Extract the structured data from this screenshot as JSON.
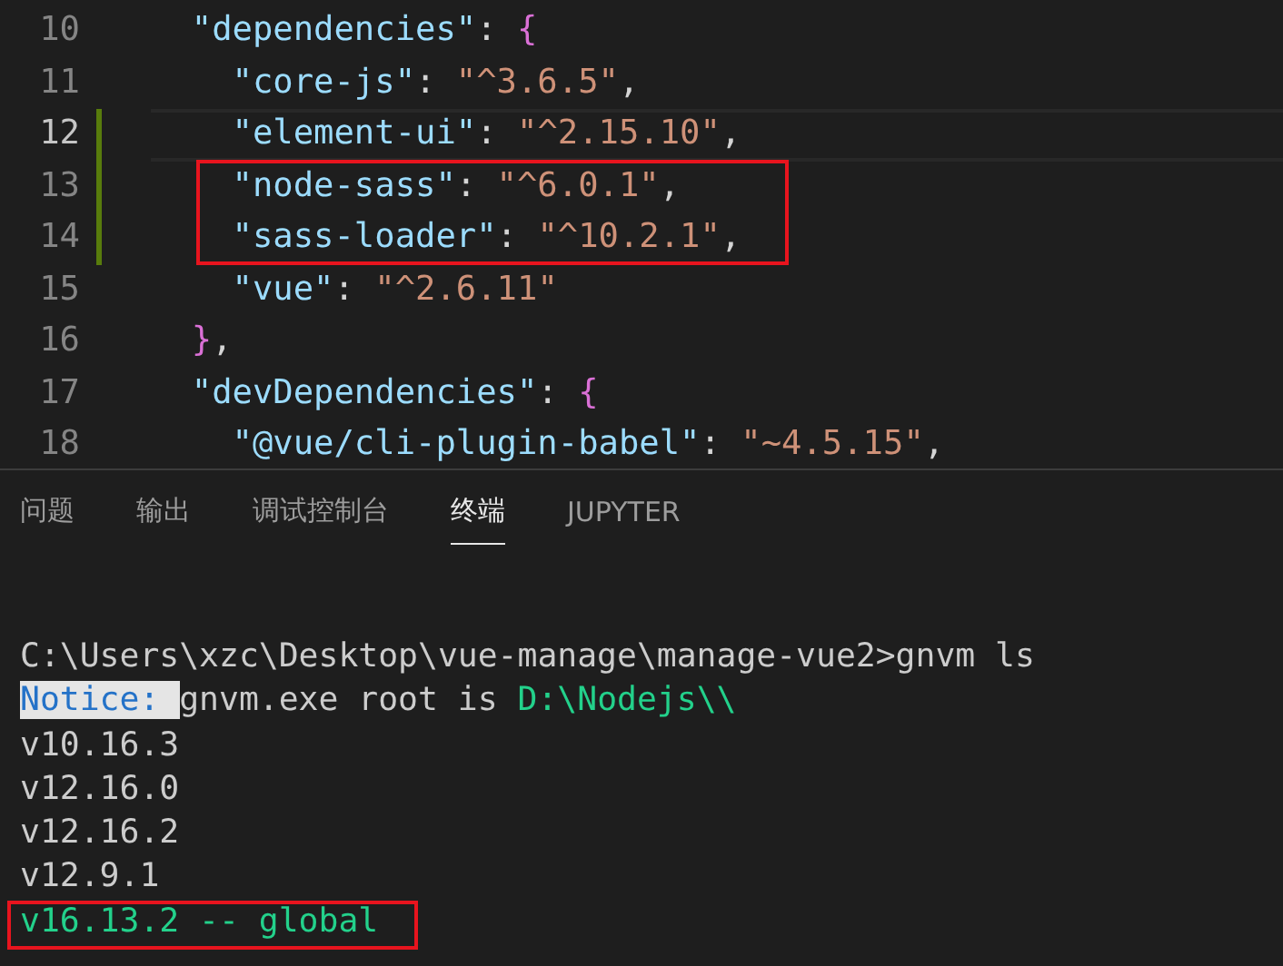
{
  "editor": {
    "lines": [
      {
        "number": "10",
        "current": false,
        "modified": false,
        "boxed": false,
        "tokens": [
          {
            "kind": "key",
            "text": "\"dependencies\""
          },
          {
            "kind": "punct",
            "text": ": "
          },
          {
            "kind": "bracket",
            "text": "{"
          }
        ],
        "children": [
          {
            "number": "11",
            "current": false,
            "modified": false,
            "boxed": false,
            "tokens": [
              {
                "kind": "key",
                "text": "\"core-js\""
              },
              {
                "kind": "punct",
                "text": ": "
              },
              {
                "kind": "string",
                "text": "\"^3.6.5\""
              },
              {
                "kind": "punct",
                "text": ","
              }
            ]
          },
          {
            "number": "12",
            "current": true,
            "modified": true,
            "boxed": false,
            "tokens": [
              {
                "kind": "key",
                "text": "\"element-ui\""
              },
              {
                "kind": "punct",
                "text": ": "
              },
              {
                "kind": "string",
                "text": "\"^2.15.10\""
              },
              {
                "kind": "punct",
                "text": ","
              }
            ]
          },
          {
            "number": "13",
            "current": false,
            "modified": true,
            "boxed": true,
            "tokens": [
              {
                "kind": "key",
                "text": "\"node-sass\""
              },
              {
                "kind": "punct",
                "text": ": "
              },
              {
                "kind": "string",
                "text": "\"^6.0.1\""
              },
              {
                "kind": "punct",
                "text": ","
              }
            ]
          },
          {
            "number": "14",
            "current": false,
            "modified": true,
            "boxed": true,
            "tokens": [
              {
                "kind": "key",
                "text": "\"sass-loader\""
              },
              {
                "kind": "punct",
                "text": ": "
              },
              {
                "kind": "string",
                "text": "\"^10.2.1\""
              },
              {
                "kind": "punct",
                "text": ","
              }
            ]
          },
          {
            "number": "15",
            "current": false,
            "modified": false,
            "boxed": false,
            "tokens": [
              {
                "kind": "key",
                "text": "\"vue\""
              },
              {
                "kind": "punct",
                "text": ": "
              },
              {
                "kind": "string",
                "text": "\"^2.6.11\""
              }
            ]
          }
        ]
      },
      {
        "number": "16",
        "current": false,
        "modified": false,
        "boxed": false,
        "tokens": [
          {
            "kind": "bracket",
            "text": "}"
          },
          {
            "kind": "punct",
            "text": ","
          }
        ]
      },
      {
        "number": "17",
        "current": false,
        "modified": false,
        "boxed": false,
        "tokens": [
          {
            "kind": "key",
            "text": "\"devDependencies\""
          },
          {
            "kind": "punct",
            "text": ": "
          },
          {
            "kind": "bracket",
            "text": "{"
          }
        ],
        "children": [
          {
            "number": "18",
            "current": false,
            "modified": false,
            "boxed": false,
            "tokens": [
              {
                "kind": "key",
                "text": "\"@vue/cli-plugin-babel\""
              },
              {
                "kind": "punct",
                "text": ": "
              },
              {
                "kind": "string",
                "text": "\"~4.5.15\""
              },
              {
                "kind": "punct",
                "text": ","
              }
            ]
          }
        ]
      }
    ]
  },
  "panel": {
    "tabs": [
      {
        "label": "问题",
        "selected": false
      },
      {
        "label": "输出",
        "selected": false
      },
      {
        "label": "调试控制台",
        "selected": false
      },
      {
        "label": "终端",
        "selected": true
      },
      {
        "label": "JUPYTER",
        "selected": false
      }
    ],
    "terminal": [
      {
        "boxed": false,
        "segments": [
          {
            "kind": "plain",
            "text": "C:\\Users\\xzc\\Desktop\\vue-manage\\manage-vue2>gnvm ls"
          }
        ]
      },
      {
        "boxed": false,
        "segments": [
          {
            "kind": "notice",
            "text": "Notice: "
          },
          {
            "kind": "plain",
            "text": "gnvm.exe root is "
          },
          {
            "kind": "green",
            "text": "D:\\Nodejs\\\\"
          }
        ]
      },
      {
        "boxed": false,
        "segments": [
          {
            "kind": "plain",
            "text": "v10.16.3"
          }
        ]
      },
      {
        "boxed": false,
        "segments": [
          {
            "kind": "plain",
            "text": "v12.16.0"
          }
        ]
      },
      {
        "boxed": false,
        "segments": [
          {
            "kind": "plain",
            "text": "v12.16.2"
          }
        ]
      },
      {
        "boxed": false,
        "segments": [
          {
            "kind": "plain",
            "text": "v12.9.1"
          }
        ]
      },
      {
        "boxed": true,
        "segments": [
          {
            "kind": "green",
            "text": "v16.13.2 -- global"
          }
        ]
      }
    ]
  }
}
